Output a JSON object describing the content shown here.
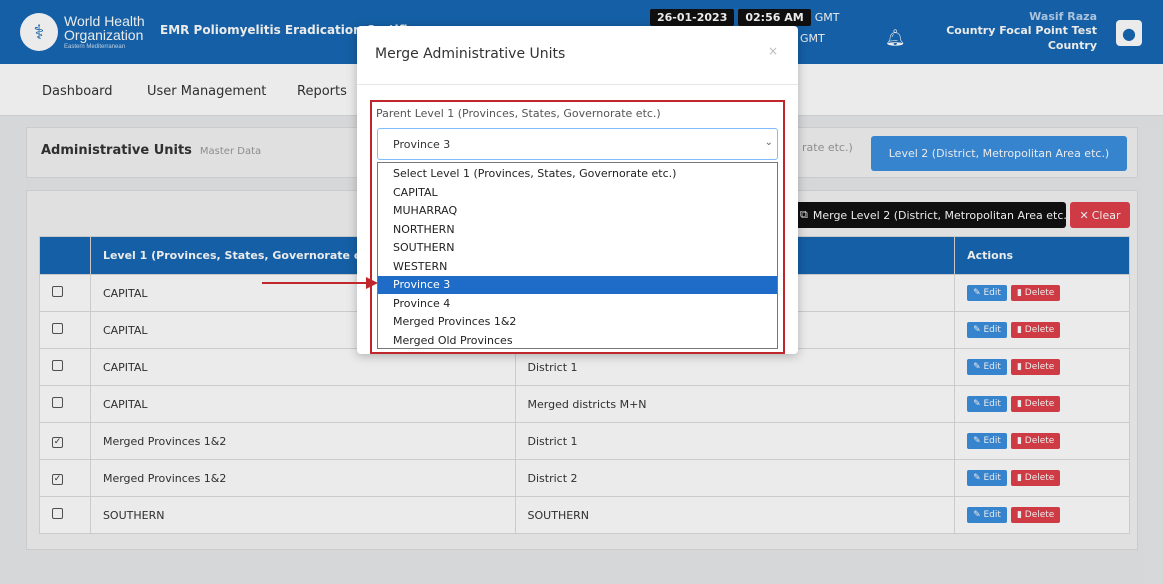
{
  "header": {
    "org_line1": "World Health",
    "org_line2": "Organization",
    "org_line3": "Eastern Mediterranean",
    "app_title": "EMR Poliomyelitis Eradication Certific",
    "date": "26-01-2023",
    "time": "02:56 AM",
    "tz1": "GMT",
    "tz2": "GMT",
    "user_name": "Wasif Raza",
    "user_role1": "Country Focal Point Test",
    "user_role2": "Country",
    "bell_icon": "bell-icon",
    "avatar_icon": "user-icon"
  },
  "nav": {
    "items": [
      "Dashboard",
      "User Management",
      "Reports"
    ]
  },
  "master": {
    "title": "Administrative Units",
    "subtitle": "Master Data",
    "level1_partial": "rate etc.)",
    "level2_button": "Level 2 (District, Metropolitan Area etc.)"
  },
  "toolbar": {
    "merge_label": "Merge Level 2 (District, Metropolitan Area etc.)",
    "clear_label": "Clear"
  },
  "table": {
    "headers": [
      "",
      "Level 1 (Provinces, States, Governorate etc.)",
      "",
      "Actions"
    ],
    "edit_label": "Edit",
    "delete_label": "Delete",
    "rows": [
      {
        "checked": false,
        "l1": "CAPITAL",
        "l2": ""
      },
      {
        "checked": false,
        "l1": "CAPITAL",
        "l2": ""
      },
      {
        "checked": false,
        "l1": "CAPITAL",
        "l2": "District 1"
      },
      {
        "checked": false,
        "l1": "CAPITAL",
        "l2": "Merged districts M+N"
      },
      {
        "checked": true,
        "l1": "Merged Provinces 1&2",
        "l2": "District 1"
      },
      {
        "checked": true,
        "l1": "Merged Provinces 1&2",
        "l2": "District 2"
      },
      {
        "checked": false,
        "l1": "SOUTHERN",
        "l2": "SOUTHERN"
      }
    ]
  },
  "modal": {
    "title": "Merge Administrative Units",
    "close": "×",
    "field_label": "Parent Level 1 (Provinces, States, Governorate etc.)",
    "selected": "Province 3",
    "options": [
      "Select Level 1 (Provinces, States, Governorate etc.)",
      "CAPITAL",
      "MUHARRAQ",
      "NORTHERN",
      "SOUTHERN",
      "WESTERN",
      "Province 3",
      "Province 4",
      "Merged Provinces 1&2",
      "Merged Old Provinces"
    ],
    "selected_index": 6
  },
  "colors": {
    "primary": "#1668b3",
    "accent": "#3b8fe0",
    "danger": "#e0414b",
    "annotation": "#c0272d"
  }
}
